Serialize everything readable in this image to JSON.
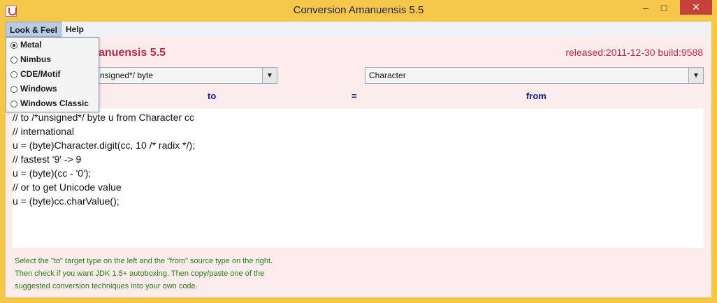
{
  "window": {
    "title": "Conversion Amanuensis 5.5",
    "minimize_glyph": "–",
    "maximize_glyph": "□",
    "close_glyph": "✕"
  },
  "menubar": {
    "items": [
      {
        "label": "Look & Feel"
      },
      {
        "label": "Help"
      }
    ]
  },
  "lookfeel_menu": {
    "options": [
      {
        "label": "Metal",
        "selected": true
      },
      {
        "label": "Nimbus",
        "selected": false
      },
      {
        "label": "CDE/Motif",
        "selected": false
      },
      {
        "label": "Windows",
        "selected": false
      },
      {
        "label": "Windows Classic",
        "selected": false
      }
    ]
  },
  "main": {
    "heading_visible": "anuensis 5.5",
    "release": "released:2011-12-30 build:9588",
    "to_combo_value": "nsigned*/ byte",
    "from_combo_value": "Character",
    "label_to": "to",
    "label_eq": "=",
    "label_from": "from",
    "code_lines": [
      "// to /*unsigned*/ byte u from Character cc",
      "// international",
      "u = (byte)Character.digit(cc, 10 /* radix */);",
      "// fastest '9' -> 9",
      "u = (byte)(cc - '0');",
      "// or to get Unicode value",
      "u = (byte)cc.charValue();"
    ],
    "help_lines": [
      "Select the \"to\" target type on the left and the  \"from\" source type on the right.",
      "Then check if you want JDK 1.5+ autoboxing. Then copy/paste one of the",
      "suggested conversion techniques into your own code."
    ]
  },
  "colors": {
    "titlebar": "#f5c84b",
    "heading": "#c0284a",
    "label_blue": "#15159a",
    "help_green": "#2c7a1a",
    "client_bg": "#fbecec"
  }
}
